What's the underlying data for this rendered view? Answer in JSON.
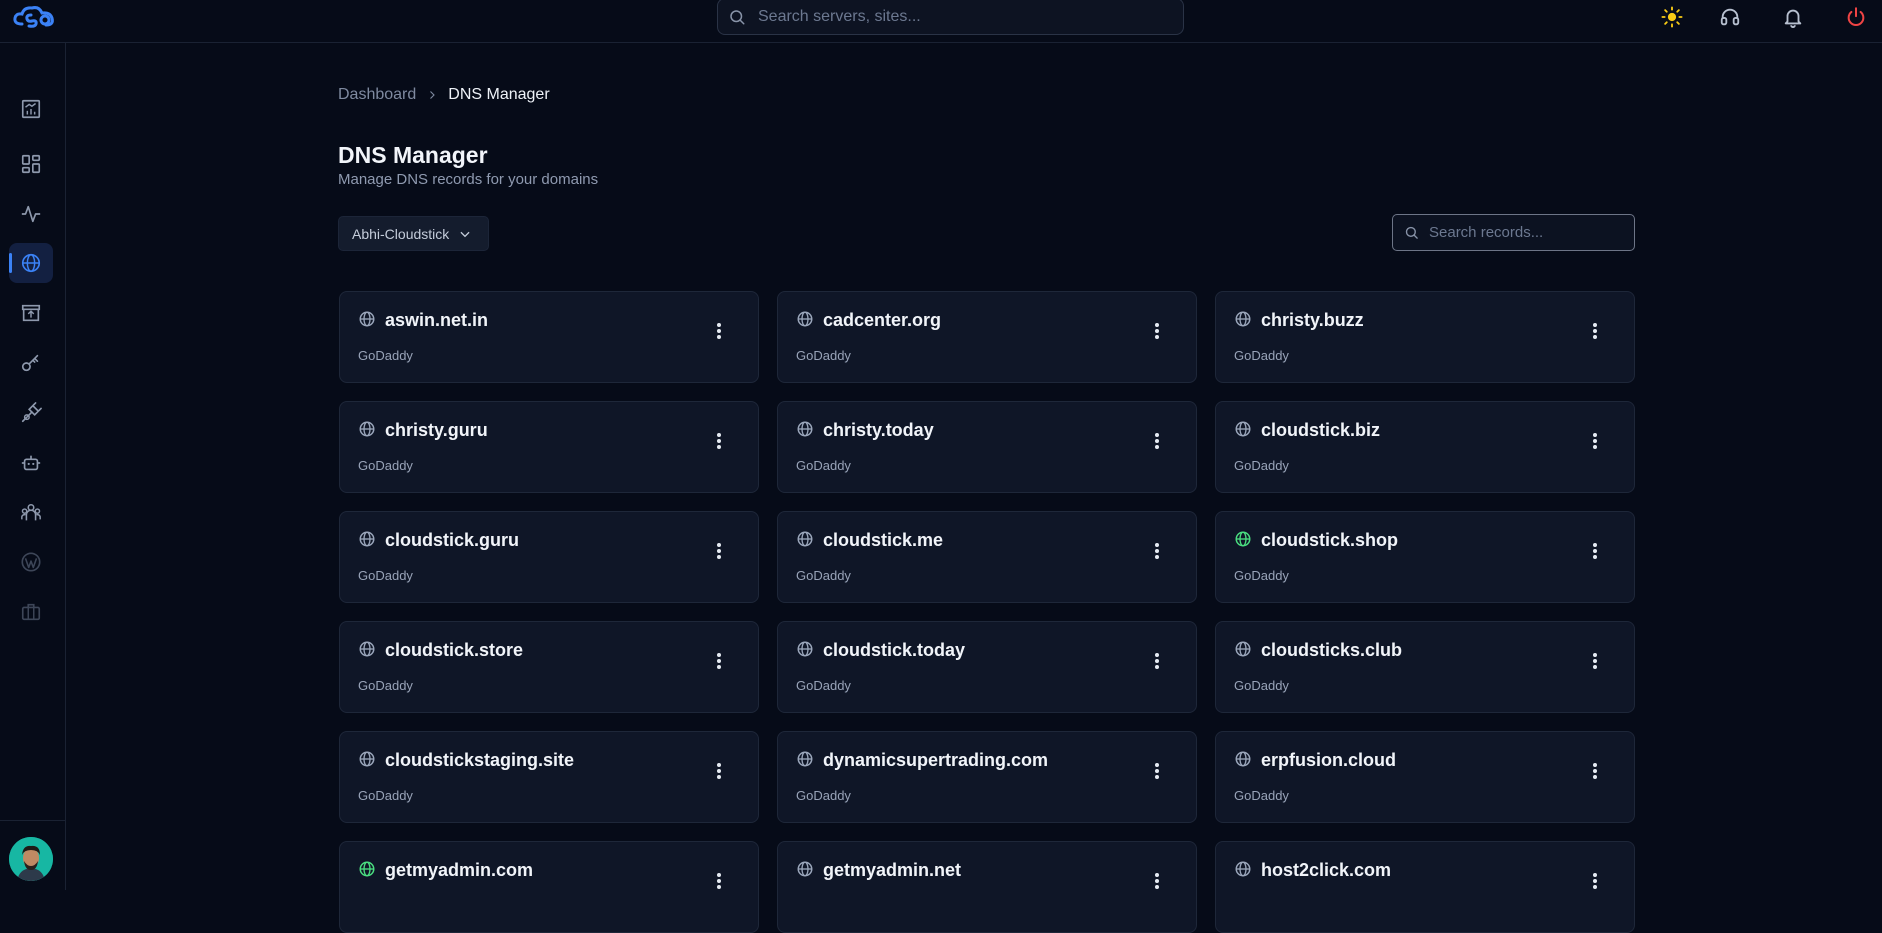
{
  "topbar": {
    "search_placeholder": "Search servers, sites..."
  },
  "sidebar": {
    "items": [
      {
        "icon": "analytics-icon",
        "active": false
      },
      {
        "icon": "dashboard-grid-icon",
        "active": false
      },
      {
        "icon": "activity-pulse-icon",
        "active": false
      },
      {
        "icon": "globe-icon",
        "active": true
      },
      {
        "icon": "storefront-icon",
        "active": false
      },
      {
        "icon": "key-icon",
        "active": false
      },
      {
        "icon": "plug-icon",
        "active": false
      },
      {
        "icon": "robot-icon",
        "active": false
      },
      {
        "icon": "team-icon",
        "active": false
      },
      {
        "icon": "wordpress-icon",
        "active": false
      },
      {
        "icon": "briefcase-icon",
        "active": false
      }
    ]
  },
  "breadcrumb": {
    "parent": "Dashboard",
    "current": "DNS Manager"
  },
  "page": {
    "title": "DNS Manager",
    "subtitle": "Manage DNS records for your domains"
  },
  "account_select": {
    "value": "Abhi-Cloudstick"
  },
  "records_search": {
    "placeholder": "Search records..."
  },
  "colors": {
    "accent": "#3b82f6",
    "active_domain_icon": "#4ade80",
    "default_domain_icon": "#9aa6bb",
    "power_icon": "#ef4444",
    "theme_icon": "#facc15"
  },
  "domains": [
    {
      "name": "aswin.net.in",
      "provider": "GoDaddy",
      "icon_active": false
    },
    {
      "name": "cadcenter.org",
      "provider": "GoDaddy",
      "icon_active": false
    },
    {
      "name": "christy.buzz",
      "provider": "GoDaddy",
      "icon_active": false
    },
    {
      "name": "christy.guru",
      "provider": "GoDaddy",
      "icon_active": false
    },
    {
      "name": "christy.today",
      "provider": "GoDaddy",
      "icon_active": false
    },
    {
      "name": "cloudstick.biz",
      "provider": "GoDaddy",
      "icon_active": false
    },
    {
      "name": "cloudstick.guru",
      "provider": "GoDaddy",
      "icon_active": false
    },
    {
      "name": "cloudstick.me",
      "provider": "GoDaddy",
      "icon_active": false
    },
    {
      "name": "cloudstick.shop",
      "provider": "GoDaddy",
      "icon_active": true
    },
    {
      "name": "cloudstick.store",
      "provider": "GoDaddy",
      "icon_active": false
    },
    {
      "name": "cloudstick.today",
      "provider": "GoDaddy",
      "icon_active": false
    },
    {
      "name": "cloudsticks.club",
      "provider": "GoDaddy",
      "icon_active": false
    },
    {
      "name": "cloudstickstaging.site",
      "provider": "GoDaddy",
      "icon_active": false
    },
    {
      "name": "dynamicsupertrading.com",
      "provider": "GoDaddy",
      "icon_active": false
    },
    {
      "name": "erpfusion.cloud",
      "provider": "GoDaddy",
      "icon_active": false
    },
    {
      "name": "getmyadmin.com",
      "provider": "",
      "icon_active": true
    },
    {
      "name": "getmyadmin.net",
      "provider": "",
      "icon_active": false
    },
    {
      "name": "host2click.com",
      "provider": "",
      "icon_active": false
    }
  ]
}
